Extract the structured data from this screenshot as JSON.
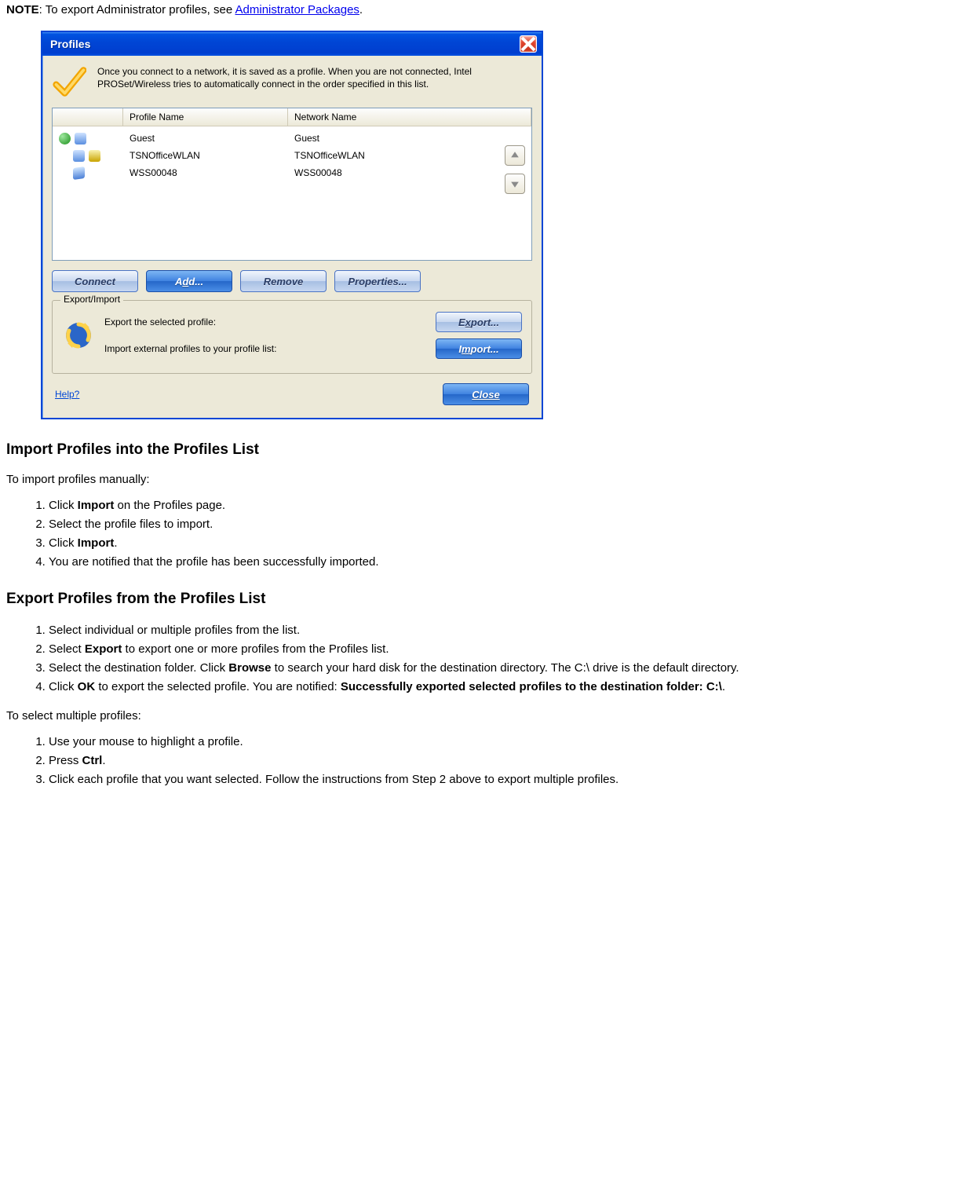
{
  "note": {
    "label": "NOTE",
    "text_before": ": To export Administrator profiles, see ",
    "link": "Administrator Packages",
    "text_after": "."
  },
  "dialog": {
    "title": "Profiles",
    "intro": "Once you connect to a network, it is saved as a profile. When you are not connected, Intel PROSet/Wireless tries to automatically connect in the order specified in this list.",
    "columns": {
      "profile": "Profile Name",
      "network": "Network Name"
    },
    "rows": [
      {
        "profile": "Guest",
        "network": "Guest",
        "icons": [
          "globe",
          "users"
        ]
      },
      {
        "profile": "TSNOfficeWLAN",
        "network": "TSNOfficeWLAN",
        "icons": [
          "users",
          "lock"
        ]
      },
      {
        "profile": "WSS00048",
        "network": "WSS00048",
        "icons": [
          "card"
        ]
      }
    ],
    "buttons": {
      "connect": "Connect",
      "add_pre": "A",
      "add_ul": "d",
      "add_post": "d...",
      "remove": "Remove",
      "properties": "Properties..."
    },
    "group": {
      "title": "Export/Import",
      "export_label": "Export the selected profile:",
      "import_label": "Import external profiles to your profile list:",
      "export_pre": "E",
      "export_ul": "x",
      "export_post": "port...",
      "import_pre": "I",
      "import_ul": "m",
      "import_post": "port..."
    },
    "help": "Help?",
    "close": "Close"
  },
  "sections": {
    "import_heading": "Import Profiles into the Profiles List",
    "import_intro": "To import profiles manually:",
    "import_steps": [
      {
        "pre": "Click ",
        "bold": "Import",
        "post": " on the Profiles page."
      },
      {
        "pre": "Select the profile files to import.",
        "bold": "",
        "post": ""
      },
      {
        "pre": "Click ",
        "bold": "Import",
        "post": "."
      },
      {
        "pre": "You are notified that the profile has been successfully imported.",
        "bold": "",
        "post": ""
      }
    ],
    "export_heading": "Export Profiles from the Profiles List",
    "export_steps": [
      {
        "pre": "Select individual or multiple profiles from the list.",
        "bold": "",
        "post": ""
      },
      {
        "pre": "Select ",
        "bold": "Export",
        "post": " to export one or more profiles from the Profiles list."
      },
      {
        "pre": "Select the destination folder. Click ",
        "bold": "Browse",
        "post": " to search your hard disk for the destination directory. The C:\\ drive is the default directory."
      },
      {
        "pre": "Click ",
        "bold": "OK",
        "post": " to export the selected profile. You are notified: ",
        "bold2": "Successfully exported selected profiles to the destination folder: C:\\",
        "post2": "."
      }
    ],
    "multi_intro": "To select multiple profiles:",
    "multi_steps": [
      {
        "pre": "Use your mouse to highlight a profile.",
        "bold": "",
        "post": ""
      },
      {
        "pre": "Press ",
        "bold": "Ctrl",
        "post": "."
      },
      {
        "pre": "Click each profile that you want selected. Follow the instructions from Step 2 above to export multiple profiles.",
        "bold": "",
        "post": ""
      }
    ]
  }
}
